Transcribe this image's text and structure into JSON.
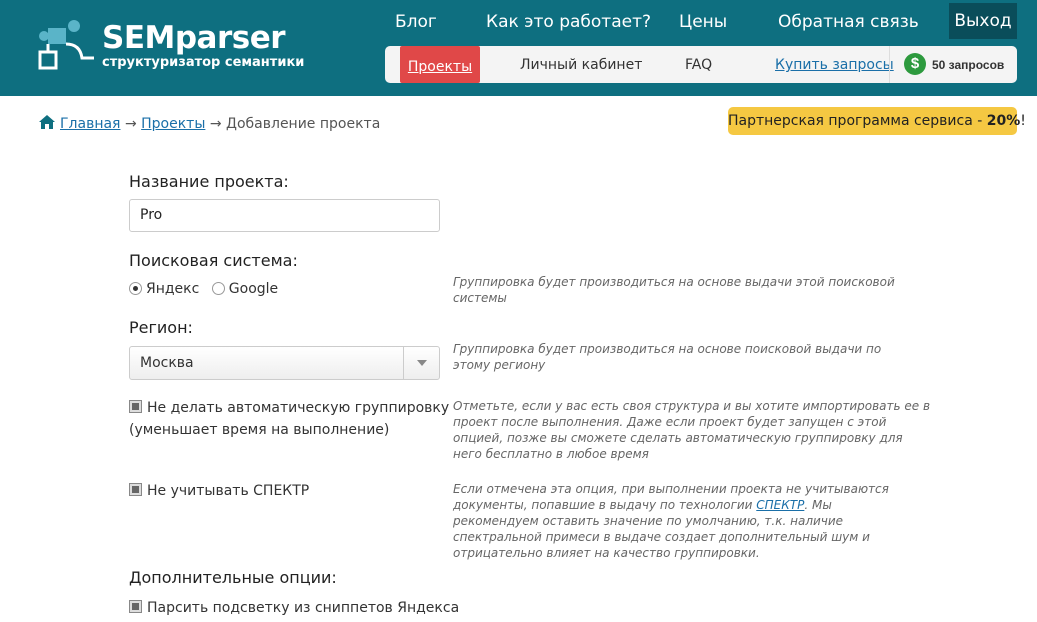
{
  "brand": {
    "name": "SEMparser",
    "tagline": "структуризатор семантики"
  },
  "topnav": {
    "blog": "Блог",
    "how": "Как это работает?",
    "prices": "Цены",
    "feedback": "Обратная связь",
    "logout": "Выход"
  },
  "subnav": {
    "projects": "Проекты",
    "cabinet": "Личный кабинет",
    "faq": "FAQ",
    "buy": "Купить запросы",
    "balance": "50 запросов",
    "balance_icon": "dollar-icon"
  },
  "breadcrumb": {
    "home": "Главная",
    "sep": "→",
    "projects": "Проекты",
    "current": "Добавление проекта"
  },
  "partner": {
    "text": "Партнерская программа сервиса - ",
    "percent": "20%",
    "suffix": "!"
  },
  "form": {
    "project_name_label": "Название проекта:",
    "project_name_value": "Pro",
    "search_engine_label": "Поисковая система:",
    "engine_yandex": "Яндекс",
    "engine_google": "Google",
    "engine_hint": "Группировка будет производиться на основе выдачи этой поисковой системы",
    "region_label": "Регион:",
    "region_value": "Москва",
    "region_hint": "Группировка будет производиться на основе поисковой выдачи по этому региону",
    "no_auto_group_line1": "Не делать автоматическую группировку",
    "no_auto_group_line2": "(уменьшает время на выполнение)",
    "no_auto_group_hint": "Отметьте, если у вас есть своя структура и вы хотите импортировать ее в проект после выполнения. Даже если проект будет запущен с этой опцией, позже вы сможете сделать автоматическую группировку для него бесплатно в любое время",
    "no_spectr": "Не учитывать СПЕКТР",
    "spectr_hint_1": "Если отмечена эта опция, при выполнении проекта не учитываются документы, попавшие в выдачу по технологии ",
    "spectr_link": "СПЕКТР",
    "spectr_hint_2": ". Мы рекомендуем оставить значение по умолчанию, т.к. наличие спектральной примеси в выдаче создает дополнительный шум и отрицательно влияет на качество группировки.",
    "extra_label": "Дополнительные опции:",
    "parse_highlight": "Парсить подсветку из сниппетов Яндекса"
  },
  "colors": {
    "header": "#0e6f80",
    "logout_bg": "#0a4d5a",
    "active_tab": "#e04848",
    "partner_bg": "#f5c842",
    "link": "#1a6fa8"
  }
}
